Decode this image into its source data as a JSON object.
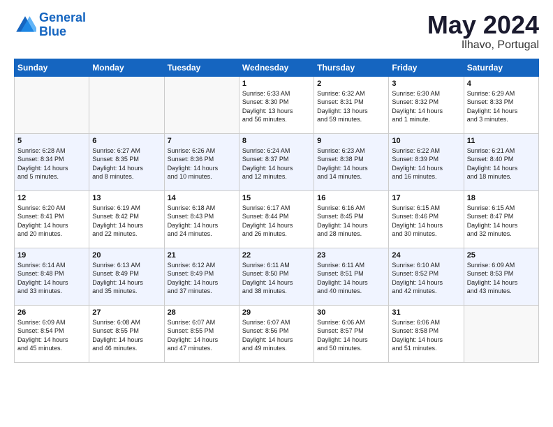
{
  "logo": {
    "line1": "General",
    "line2": "Blue"
  },
  "title": "May 2024",
  "location": "Ilhavo, Portugal",
  "weekdays": [
    "Sunday",
    "Monday",
    "Tuesday",
    "Wednesday",
    "Thursday",
    "Friday",
    "Saturday"
  ],
  "weeks": [
    [
      {
        "day": "",
        "content": ""
      },
      {
        "day": "",
        "content": ""
      },
      {
        "day": "",
        "content": ""
      },
      {
        "day": "1",
        "content": "Sunrise: 6:33 AM\nSunset: 8:30 PM\nDaylight: 13 hours\nand 56 minutes."
      },
      {
        "day": "2",
        "content": "Sunrise: 6:32 AM\nSunset: 8:31 PM\nDaylight: 13 hours\nand 59 minutes."
      },
      {
        "day": "3",
        "content": "Sunrise: 6:30 AM\nSunset: 8:32 PM\nDaylight: 14 hours\nand 1 minute."
      },
      {
        "day": "4",
        "content": "Sunrise: 6:29 AM\nSunset: 8:33 PM\nDaylight: 14 hours\nand 3 minutes."
      }
    ],
    [
      {
        "day": "5",
        "content": "Sunrise: 6:28 AM\nSunset: 8:34 PM\nDaylight: 14 hours\nand 5 minutes."
      },
      {
        "day": "6",
        "content": "Sunrise: 6:27 AM\nSunset: 8:35 PM\nDaylight: 14 hours\nand 8 minutes."
      },
      {
        "day": "7",
        "content": "Sunrise: 6:26 AM\nSunset: 8:36 PM\nDaylight: 14 hours\nand 10 minutes."
      },
      {
        "day": "8",
        "content": "Sunrise: 6:24 AM\nSunset: 8:37 PM\nDaylight: 14 hours\nand 12 minutes."
      },
      {
        "day": "9",
        "content": "Sunrise: 6:23 AM\nSunset: 8:38 PM\nDaylight: 14 hours\nand 14 minutes."
      },
      {
        "day": "10",
        "content": "Sunrise: 6:22 AM\nSunset: 8:39 PM\nDaylight: 14 hours\nand 16 minutes."
      },
      {
        "day": "11",
        "content": "Sunrise: 6:21 AM\nSunset: 8:40 PM\nDaylight: 14 hours\nand 18 minutes."
      }
    ],
    [
      {
        "day": "12",
        "content": "Sunrise: 6:20 AM\nSunset: 8:41 PM\nDaylight: 14 hours\nand 20 minutes."
      },
      {
        "day": "13",
        "content": "Sunrise: 6:19 AM\nSunset: 8:42 PM\nDaylight: 14 hours\nand 22 minutes."
      },
      {
        "day": "14",
        "content": "Sunrise: 6:18 AM\nSunset: 8:43 PM\nDaylight: 14 hours\nand 24 minutes."
      },
      {
        "day": "15",
        "content": "Sunrise: 6:17 AM\nSunset: 8:44 PM\nDaylight: 14 hours\nand 26 minutes."
      },
      {
        "day": "16",
        "content": "Sunrise: 6:16 AM\nSunset: 8:45 PM\nDaylight: 14 hours\nand 28 minutes."
      },
      {
        "day": "17",
        "content": "Sunrise: 6:15 AM\nSunset: 8:46 PM\nDaylight: 14 hours\nand 30 minutes."
      },
      {
        "day": "18",
        "content": "Sunrise: 6:15 AM\nSunset: 8:47 PM\nDaylight: 14 hours\nand 32 minutes."
      }
    ],
    [
      {
        "day": "19",
        "content": "Sunrise: 6:14 AM\nSunset: 8:48 PM\nDaylight: 14 hours\nand 33 minutes."
      },
      {
        "day": "20",
        "content": "Sunrise: 6:13 AM\nSunset: 8:49 PM\nDaylight: 14 hours\nand 35 minutes."
      },
      {
        "day": "21",
        "content": "Sunrise: 6:12 AM\nSunset: 8:49 PM\nDaylight: 14 hours\nand 37 minutes."
      },
      {
        "day": "22",
        "content": "Sunrise: 6:11 AM\nSunset: 8:50 PM\nDaylight: 14 hours\nand 38 minutes."
      },
      {
        "day": "23",
        "content": "Sunrise: 6:11 AM\nSunset: 8:51 PM\nDaylight: 14 hours\nand 40 minutes."
      },
      {
        "day": "24",
        "content": "Sunrise: 6:10 AM\nSunset: 8:52 PM\nDaylight: 14 hours\nand 42 minutes."
      },
      {
        "day": "25",
        "content": "Sunrise: 6:09 AM\nSunset: 8:53 PM\nDaylight: 14 hours\nand 43 minutes."
      }
    ],
    [
      {
        "day": "26",
        "content": "Sunrise: 6:09 AM\nSunset: 8:54 PM\nDaylight: 14 hours\nand 45 minutes."
      },
      {
        "day": "27",
        "content": "Sunrise: 6:08 AM\nSunset: 8:55 PM\nDaylight: 14 hours\nand 46 minutes."
      },
      {
        "day": "28",
        "content": "Sunrise: 6:07 AM\nSunset: 8:55 PM\nDaylight: 14 hours\nand 47 minutes."
      },
      {
        "day": "29",
        "content": "Sunrise: 6:07 AM\nSunset: 8:56 PM\nDaylight: 14 hours\nand 49 minutes."
      },
      {
        "day": "30",
        "content": "Sunrise: 6:06 AM\nSunset: 8:57 PM\nDaylight: 14 hours\nand 50 minutes."
      },
      {
        "day": "31",
        "content": "Sunrise: 6:06 AM\nSunset: 8:58 PM\nDaylight: 14 hours\nand 51 minutes."
      },
      {
        "day": "",
        "content": ""
      }
    ]
  ]
}
